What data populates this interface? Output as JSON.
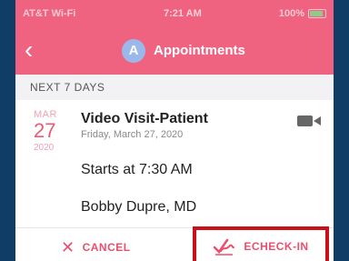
{
  "status_bar": {
    "carrier": "AT&T Wi-Fi",
    "time": "7:21 AM",
    "battery": "100%"
  },
  "header": {
    "avatar_initial": "A",
    "title": "Appointments"
  },
  "section": {
    "label": "NEXT 7 DAYS"
  },
  "appointment": {
    "month": "MAR",
    "day": "27",
    "year": "2020",
    "title": "Video Visit-Patient",
    "full_date": "Friday, March 27, 2020",
    "starts": "Starts at 7:30 AM",
    "provider": "Bobby Dupre, MD",
    "icon": "video-camera-icon"
  },
  "actions": {
    "cancel_label": "CANCEL",
    "echeck_label": "ECHECK-IN"
  },
  "colors": {
    "header": "#ef6380",
    "accent": "#ef4d6c",
    "highlight_border": "#c9111a",
    "background": "#0f3d66"
  }
}
